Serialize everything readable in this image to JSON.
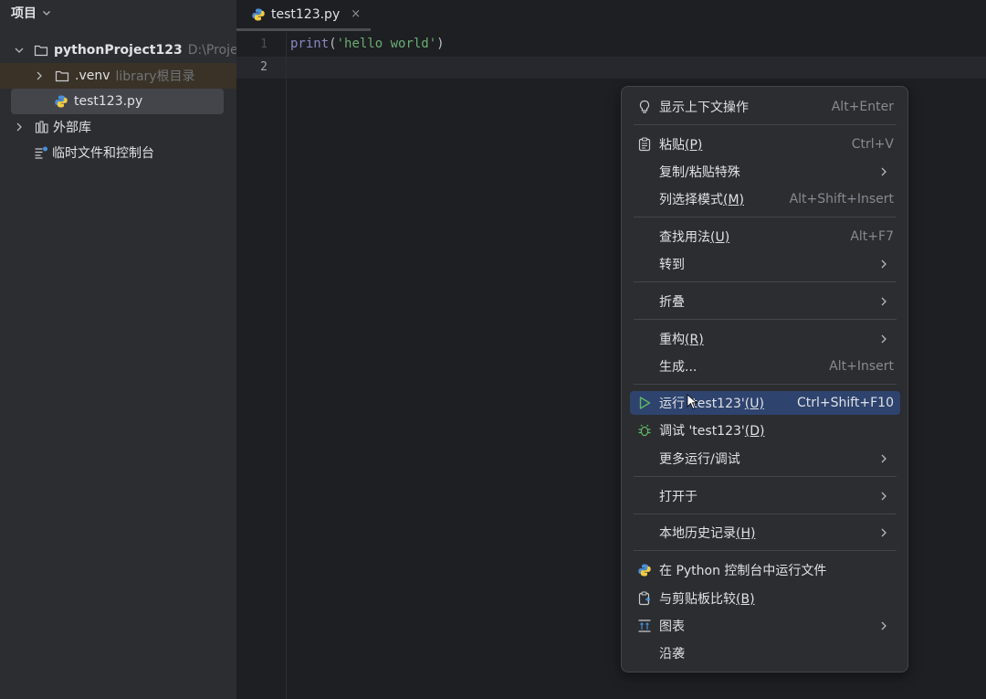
{
  "project_panel": {
    "title": "项目",
    "tree": [
      {
        "name": "pythonProject123",
        "hint": "D:\\Project"
      },
      {
        "name": ".venv",
        "hint": "library根目录"
      },
      {
        "name": "test123.py"
      },
      {
        "name": "外部库"
      },
      {
        "name": "临时文件和控制台"
      }
    ]
  },
  "editor": {
    "tab": {
      "name": "test123.py",
      "close": "×"
    },
    "line_numbers": [
      "1",
      "2"
    ],
    "code": {
      "fn": "print",
      "open": "(",
      "str": "'hello world'",
      "close": ")"
    }
  },
  "context_menu": {
    "items": [
      {
        "label": "显示上下文操作",
        "mnemonic": "",
        "shortcut": "Alt+Enter"
      },
      {
        "label": "粘贴",
        "mnemonic": "(P)",
        "shortcut": "Ctrl+V"
      },
      {
        "label": "复制/粘贴特殊",
        "mnemonic": "",
        "shortcut": ""
      },
      {
        "label": "列选择模式",
        "mnemonic": "(M)",
        "shortcut": "Alt+Shift+Insert"
      },
      {
        "label": "查找用法",
        "mnemonic": "(U)",
        "shortcut": "Alt+F7"
      },
      {
        "label": "转到",
        "mnemonic": "",
        "shortcut": ""
      },
      {
        "label": "折叠",
        "mnemonic": "",
        "shortcut": ""
      },
      {
        "label": "重构",
        "mnemonic": "(R)",
        "shortcut": ""
      },
      {
        "label": "生成...",
        "mnemonic": "",
        "shortcut": "Alt+Insert"
      },
      {
        "label": "运行 'test123'",
        "mnemonic": "(U)",
        "shortcut": "Ctrl+Shift+F10"
      },
      {
        "label": "调试 'test123'",
        "mnemonic": "(D)",
        "shortcut": ""
      },
      {
        "label": "更多运行/调试",
        "mnemonic": "",
        "shortcut": ""
      },
      {
        "label": "打开于",
        "mnemonic": "",
        "shortcut": ""
      },
      {
        "label": "本地历史记录",
        "mnemonic": "(H)",
        "shortcut": ""
      },
      {
        "label": "在 Python 控制台中运行文件",
        "mnemonic": "",
        "shortcut": ""
      },
      {
        "label": "与剪贴板比较",
        "mnemonic": "(B)",
        "shortcut": ""
      },
      {
        "label": "图表",
        "mnemonic": "",
        "shortcut": ""
      },
      {
        "label": "沿袭",
        "mnemonic": "",
        "shortcut": ""
      }
    ]
  },
  "colors": {
    "background": "#1e1f22",
    "panel": "#2b2d30",
    "selection": "#43454a",
    "menu_highlight": "#2e436e",
    "run_green": "#5fb865",
    "string_green": "#6aab73"
  }
}
